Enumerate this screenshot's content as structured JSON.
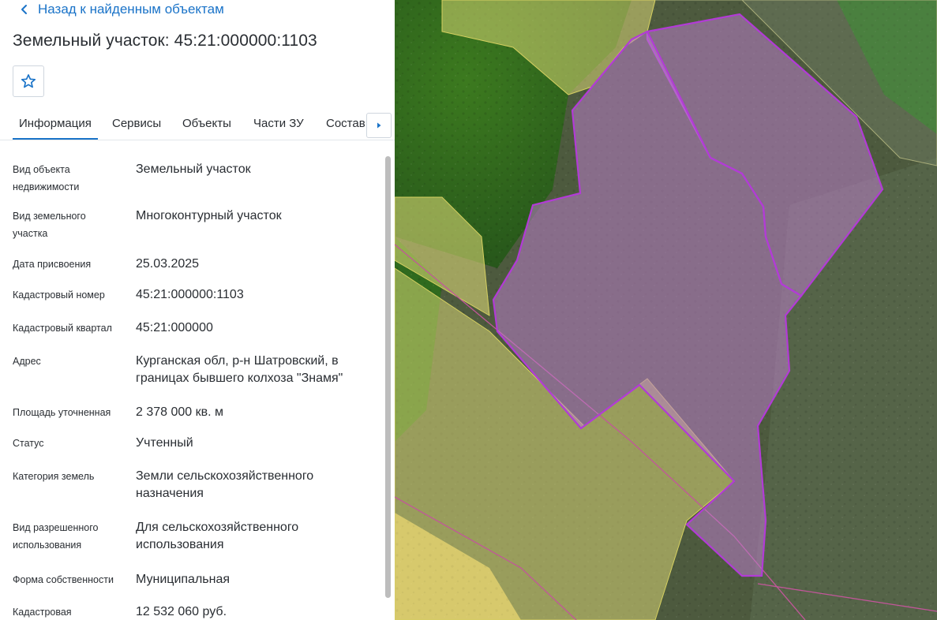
{
  "back": {
    "label": "Назад к найденным объектам"
  },
  "title": "Земельный участок: 45:21:000000:1103",
  "tabs": [
    {
      "label": "Информация",
      "active": true
    },
    {
      "label": "Сервисы"
    },
    {
      "label": "Объекты"
    },
    {
      "label": "Части ЗУ"
    },
    {
      "label": "Состав"
    }
  ],
  "info": {
    "object_type": {
      "label_1": "Вид объекта",
      "label_2": "недвижимости",
      "value": "Земельный участок"
    },
    "land_type": {
      "label_1": "Вид земельного",
      "label_2": "участка",
      "value": "Многоконтурный участок"
    },
    "date": {
      "label": "Дата присвоения",
      "value": "25.03.2025"
    },
    "cadastral_number": {
      "label": "Кадастровый номер",
      "value": "45:21:000000:1103"
    },
    "cadastral_quarter": {
      "label": "Кадастровый квартал",
      "value": "45:21:000000"
    },
    "address": {
      "label": "Адрес",
      "value_1": "Курганская обл, р-н Шатровский, в",
      "value_2": "границах бывшего колхоза \"Знамя\""
    },
    "area": {
      "label": "Площадь уточненная",
      "value": "2 378 000 кв. м"
    },
    "status": {
      "label": "Статус",
      "value": "Учтенный"
    },
    "category": {
      "label": "Категория земель",
      "value_1": "Земли сельскохозяйственного",
      "value_2": "назначения"
    },
    "permitted_use": {
      "label_1": "Вид разрешенного",
      "label_2": "использования",
      "value_1": "Для сельскохозяйственного",
      "value_2": "использования"
    },
    "ownership": {
      "label": "Форма собственности",
      "value": "Муниципальная"
    },
    "cadastral_value": {
      "label": "Кадастровая",
      "value": "12 532 060 руб."
    }
  },
  "colors": {
    "accent": "#1a73c8",
    "parcel_outline": "#b23bd6",
    "parcel_fill": "#b97ec8",
    "neighbor_fill": "#e6e07a"
  }
}
